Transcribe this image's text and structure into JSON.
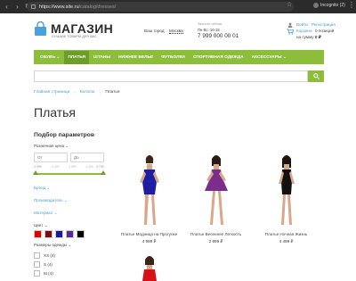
{
  "browser": {
    "url_host": "https://www.site.ru",
    "url_path": "/catalog/dresses/",
    "profile": "Incognito (2)"
  },
  "header": {
    "logo_title": "МАГАЗИН",
    "logo_subtitle": "ЛУЧШИЕ ТОВАРЫ ДЛЯ ВАС",
    "city_label": "Ваш город:",
    "city_value": "Москва",
    "phone_label": "Звоните сейчас",
    "hours": "Пн-Вс: 10-19",
    "phone": "7 999 000 00 01",
    "login": "Войти",
    "register": "Регистрация",
    "cart_link": "Корзина",
    "cart_count": "0 позиций",
    "cart_sum_label": "на сумму",
    "cart_sum_value": "0 ₽"
  },
  "nav": {
    "items": [
      "ОБУВЬ ⌄",
      "ПЛАТЬЯ",
      "ШТАНЫ",
      "НИЖНЕЕ БЕЛЬЕ",
      "ФУТБОЛКИ",
      "СПОРТИВНАЯ ОДЕЖДА",
      "АКСЕССУАРЫ ⌄"
    ],
    "active_index": 1
  },
  "search": {
    "value": ""
  },
  "breadcrumbs": {
    "home": "Главная страница",
    "catalog": "Каталог",
    "current": "Платья"
  },
  "page_title": "Платья",
  "filters": {
    "title": "Подбор параметров",
    "price_label": "Розничная цена ⌄",
    "price_from_placeholder": "От",
    "price_to_placeholder": "До",
    "scale": [
      "2 999",
      "3 449",
      "3 899",
      "4 349",
      "4 799"
    ],
    "price_range": [
      2999,
      4799
    ],
    "brand": "Бренд ⌄",
    "manufacturer": "Производитель ⌄",
    "material": "Материал ⌄",
    "color_label": "Цвет ⌄",
    "colors": [
      "#e00000",
      "#7a0a16",
      "#1a1aa0",
      "#5a2a8a",
      "#000000"
    ],
    "sizes_label": "Размеры одежды ⌄",
    "sizes": [
      "XS (4)",
      "S (4)",
      "M (4)"
    ]
  },
  "products": [
    {
      "name": "Платье Модница на Прогулке",
      "price": "4 999 ₽",
      "dress_color": "#1d1fa0"
    },
    {
      "name": "Платье Весеннее Легкость",
      "price": "2 999 ₽",
      "dress_color": "#7b2d8e"
    },
    {
      "name": "Платье Ночная Жизнь",
      "price": "4 499 ₽",
      "dress_color": "#111111"
    },
    {
      "name": "",
      "price": "",
      "dress_color": "#d8101a"
    }
  ],
  "colors": {
    "accent": "#8cbe3c",
    "accent_dark": "#6f9e28",
    "link": "#4aa0d8"
  }
}
